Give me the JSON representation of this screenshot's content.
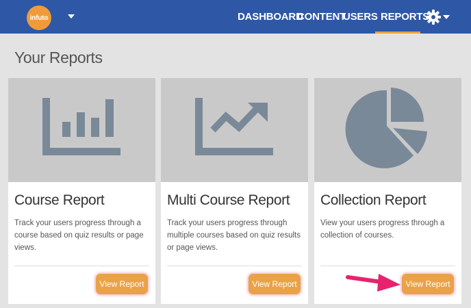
{
  "header": {
    "logo_text": "infuto",
    "nav": [
      "DASHBOARD",
      "CONTENT",
      "USERS",
      "REPORTS"
    ],
    "active_nav": "REPORTS",
    "accent_color": "#e8a33d",
    "bar_color": "#2e57a6",
    "settings_icon": "gear-icon"
  },
  "page": {
    "title": "Your Reports"
  },
  "cards": [
    {
      "title": "Course Report",
      "description": "Track your users progress through a course based on quiz results or page views.",
      "icon": "bar-chart-icon",
      "button": "View Report"
    },
    {
      "title": "Multi Course Report",
      "description": "Track your users progress through multiple courses based on quiz results or page views.",
      "icon": "line-chart-icon",
      "button": "View Report"
    },
    {
      "title": "Collection Report",
      "description": "View your users progress through a collection of courses.",
      "icon": "pie-chart-icon",
      "button": "View Report"
    }
  ]
}
